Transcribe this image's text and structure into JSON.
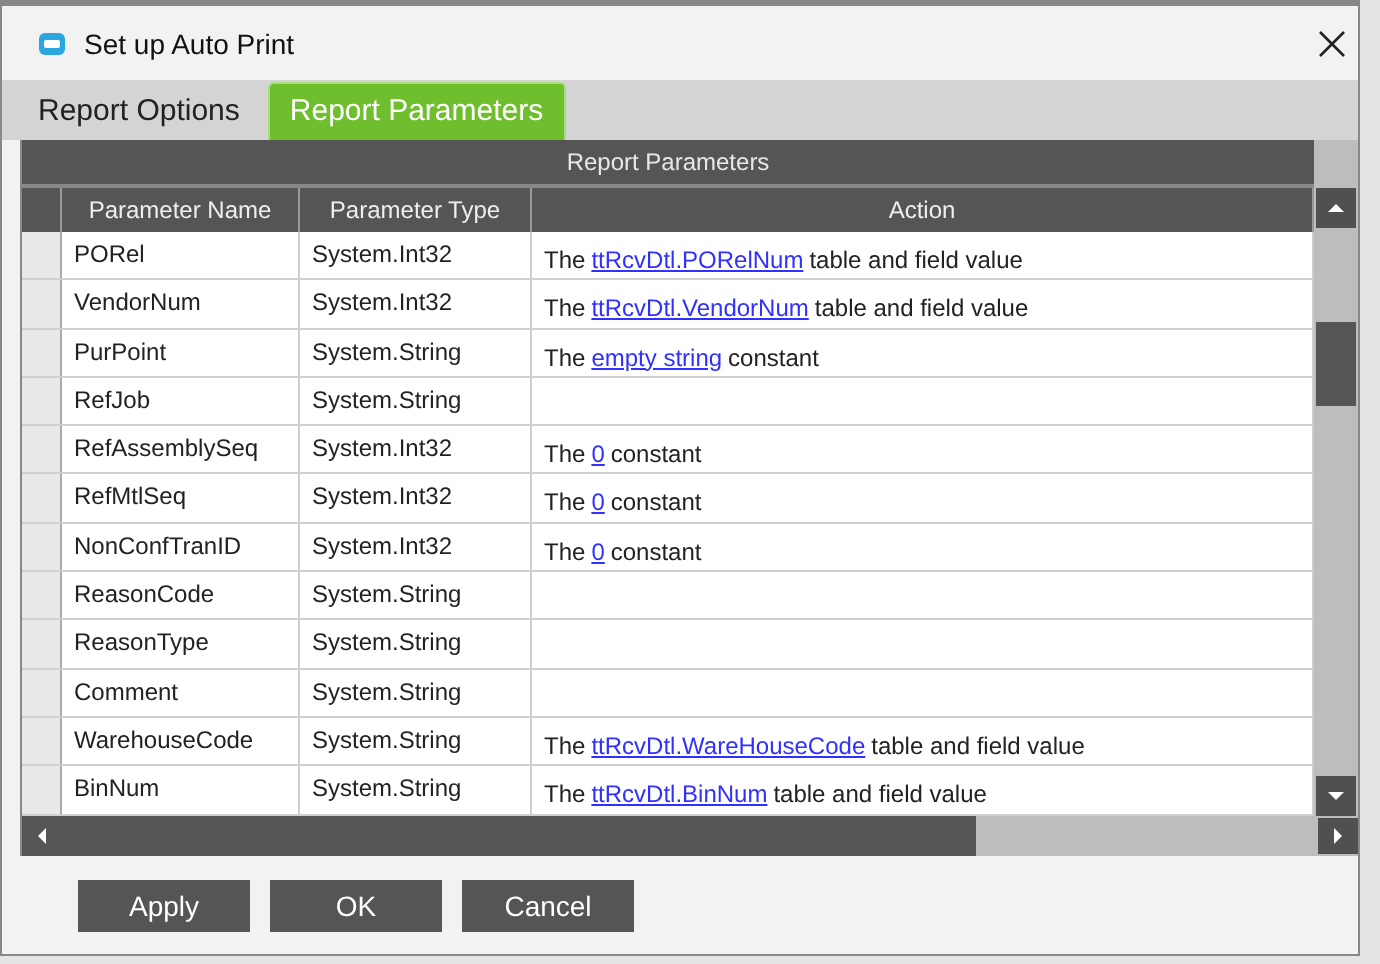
{
  "window": {
    "title": "Set up Auto Print"
  },
  "tabs": [
    {
      "label": "Report Options",
      "selected": false
    },
    {
      "label": "Report Parameters",
      "selected": true
    }
  ],
  "table": {
    "title": "Report Parameters",
    "columns": [
      "Parameter Name",
      "Parameter Type",
      "Action"
    ],
    "rows": [
      {
        "name": "PORel",
        "type": "System.Int32",
        "action": {
          "prefix": "The",
          "link": "ttRcvDtl.PORelNum",
          "suffix": "table and field value"
        }
      },
      {
        "name": "VendorNum",
        "type": "System.Int32",
        "action": {
          "prefix": "The",
          "link": "ttRcvDtl.VendorNum",
          "suffix": "table and field value"
        }
      },
      {
        "name": "PurPoint",
        "type": "System.String",
        "action": {
          "prefix": "The",
          "link": "empty string",
          "suffix": "constant"
        }
      },
      {
        "name": "RefJob",
        "type": "System.String"
      },
      {
        "name": "RefAssemblySeq",
        "type": "System.Int32",
        "action": {
          "prefix": "The",
          "link": "0",
          "suffix": "constant"
        }
      },
      {
        "name": "RefMtlSeq",
        "type": "System.Int32",
        "action": {
          "prefix": "The",
          "link": "0",
          "suffix": "constant"
        }
      },
      {
        "name": "NonConfTranID",
        "type": "System.Int32",
        "action": {
          "prefix": "The",
          "link": "0",
          "suffix": "constant"
        }
      },
      {
        "name": "ReasonCode",
        "type": "System.String"
      },
      {
        "name": "ReasonType",
        "type": "System.String"
      },
      {
        "name": "Comment",
        "type": "System.String"
      },
      {
        "name": "WarehouseCode",
        "type": "System.String",
        "action": {
          "prefix": "The",
          "link": "ttRcvDtl.WareHouseCode",
          "suffix": "table and field value"
        }
      },
      {
        "name": "BinNum",
        "type": "System.String",
        "action": {
          "prefix": "The",
          "link": "ttRcvDtl.BinNum",
          "suffix": "table and field value"
        }
      }
    ]
  },
  "buttons": [
    "Apply",
    "OK",
    "Cancel"
  ]
}
